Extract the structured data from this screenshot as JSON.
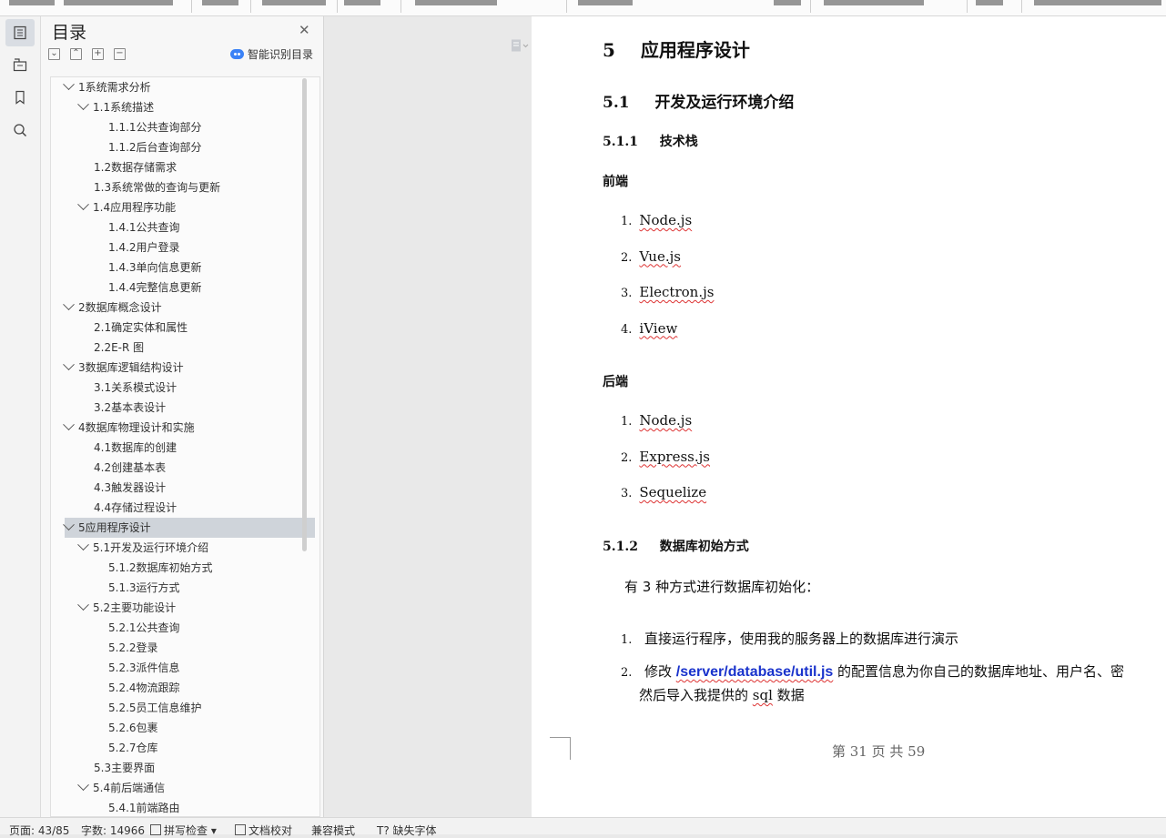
{
  "sidebar_panel": {
    "title": "目录",
    "smart_label": "智能识别目录",
    "items": [
      {
        "label": "1系统需求分析",
        "level": 0,
        "expanded": true
      },
      {
        "label": "1.1系统描述",
        "level": 1,
        "expanded": true
      },
      {
        "label": "1.1.1公共查询部分",
        "level": 2
      },
      {
        "label": "1.1.2后台查询部分",
        "level": 2
      },
      {
        "label": "1.2数据存储需求",
        "level": 1
      },
      {
        "label": "1.3系统常做的查询与更新",
        "level": 1
      },
      {
        "label": "1.4应用程序功能",
        "level": 1,
        "expanded": true
      },
      {
        "label": "1.4.1公共查询",
        "level": 2
      },
      {
        "label": "1.4.2用户登录",
        "level": 2
      },
      {
        "label": "1.4.3单向信息更新",
        "level": 2
      },
      {
        "label": "1.4.4完整信息更新",
        "level": 2
      },
      {
        "label": "2数据库概念设计",
        "level": 0,
        "expanded": true
      },
      {
        "label": "2.1确定实体和属性",
        "level": 1
      },
      {
        "label": "2.2E-R 图",
        "level": 1
      },
      {
        "label": "3数据库逻辑结构设计",
        "level": 0,
        "expanded": true
      },
      {
        "label": "3.1关系模式设计",
        "level": 1
      },
      {
        "label": "3.2基本表设计",
        "level": 1
      },
      {
        "label": "4数据库物理设计和实施",
        "level": 0,
        "expanded": true
      },
      {
        "label": "4.1数据库的创建",
        "level": 1
      },
      {
        "label": "4.2创建基本表",
        "level": 1
      },
      {
        "label": "4.3触发器设计",
        "level": 1
      },
      {
        "label": "4.4存储过程设计",
        "level": 1
      },
      {
        "label": "5应用程序设计",
        "level": 0,
        "expanded": true,
        "selected": true
      },
      {
        "label": "5.1开发及运行环境介绍",
        "level": 1,
        "expanded": true
      },
      {
        "label": "5.1.2数据库初始方式",
        "level": 2
      },
      {
        "label": "5.1.3运行方式",
        "level": 2
      },
      {
        "label": "5.2主要功能设计",
        "level": 1,
        "expanded": true
      },
      {
        "label": "5.2.1公共查询",
        "level": 2
      },
      {
        "label": "5.2.2登录",
        "level": 2
      },
      {
        "label": "5.2.3派件信息",
        "level": 2
      },
      {
        "label": "5.2.4物流跟踪",
        "level": 2
      },
      {
        "label": "5.2.5员工信息维护",
        "level": 2
      },
      {
        "label": "5.2.6包裹",
        "level": 2
      },
      {
        "label": "5.2.7仓库",
        "level": 2
      },
      {
        "label": "5.3主要界面",
        "level": 1
      },
      {
        "label": "5.4前后端通信",
        "level": 1,
        "expanded": true
      },
      {
        "label": "5.4.1前端路由",
        "level": 2
      }
    ]
  },
  "document": {
    "h1_num": "5",
    "h1_text": "应用程序设计",
    "h2_num": "5.1",
    "h2_text": "开发及运行环境介绍",
    "h3a_num": "5.1.1",
    "h3a_text": "技术栈",
    "frontend_label": "前端",
    "frontend_list": [
      "Node.js",
      "Vue.js",
      "Electron.js",
      "iView"
    ],
    "backend_label": "后端",
    "backend_list": [
      "Node.js",
      "Express.js",
      "Sequelize"
    ],
    "h3b_num": "5.1.2",
    "h3b_text": "数据库初始方式",
    "intro": "有  3 种方式进行数据库初始化：",
    "step1": "直接运行程序，使用我的服务器上的数据库进行演示",
    "step2_pre": "修改 ",
    "step2_path": "/server/database/util.js",
    "step2_post": " 的配置信息为你自己的数据库地址、用户名、密",
    "step2_line2_pre": "然后导入我提供的 ",
    "step2_sql": "sql",
    "step2_line2_post": " 数据",
    "footer": "第 31 页 共 59"
  },
  "status_bar": {
    "page": "页面: 43/85",
    "words": "字数: 14966",
    "spell": "拼写检查",
    "proof": "文档校对",
    "compat": "兼容模式",
    "fonts": "缺失字体"
  },
  "colors": {
    "link_blue": "#1a33cc",
    "selected_row": "#cfd4da",
    "smart_icon": "#3b82f6"
  }
}
